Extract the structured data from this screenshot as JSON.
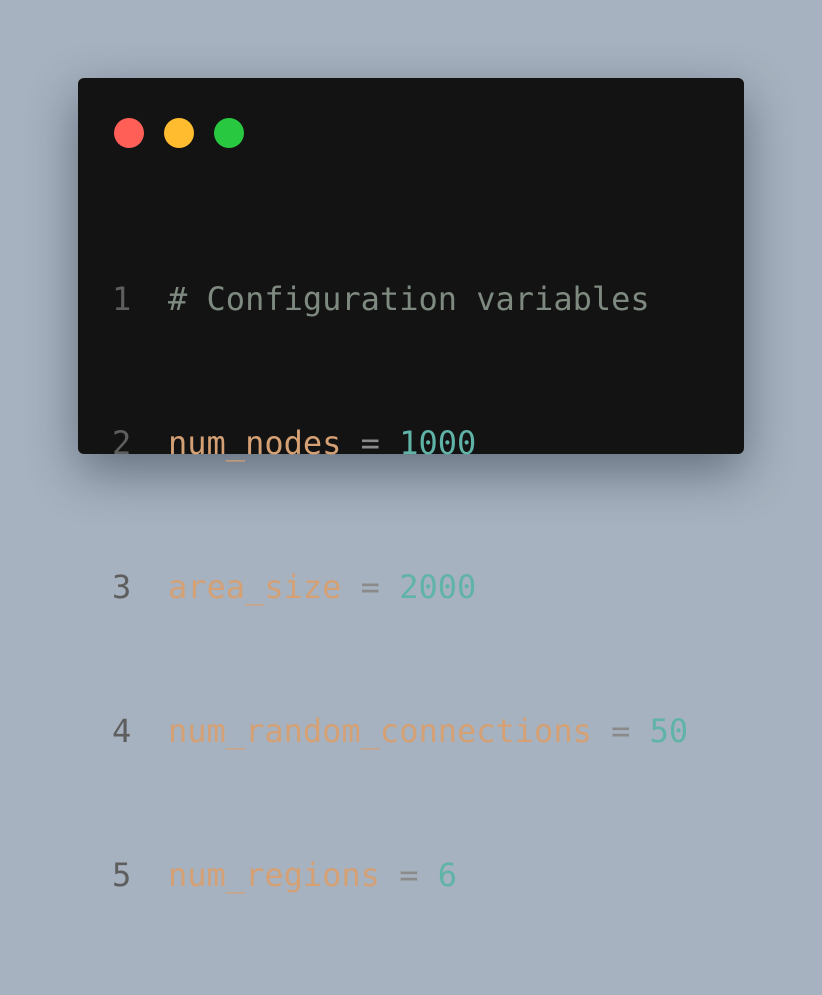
{
  "window": {
    "traffic_lights": [
      {
        "name": "close",
        "color": "#ff5f57"
      },
      {
        "name": "minimize",
        "color": "#febc2e"
      },
      {
        "name": "maximize",
        "color": "#28c840"
      }
    ]
  },
  "code": {
    "lines": [
      {
        "number": "1",
        "comment": "# Configuration variables"
      },
      {
        "number": "2",
        "var": "num_nodes",
        "op": " = ",
        "value": "1000"
      },
      {
        "number": "3",
        "var": "area_size",
        "op": " = ",
        "value": "2000"
      },
      {
        "number": "4",
        "var": "num_random_connections",
        "op": " = ",
        "value": "50"
      },
      {
        "number": "5",
        "var": "num_regions",
        "op": " = ",
        "value": "6"
      }
    ]
  }
}
